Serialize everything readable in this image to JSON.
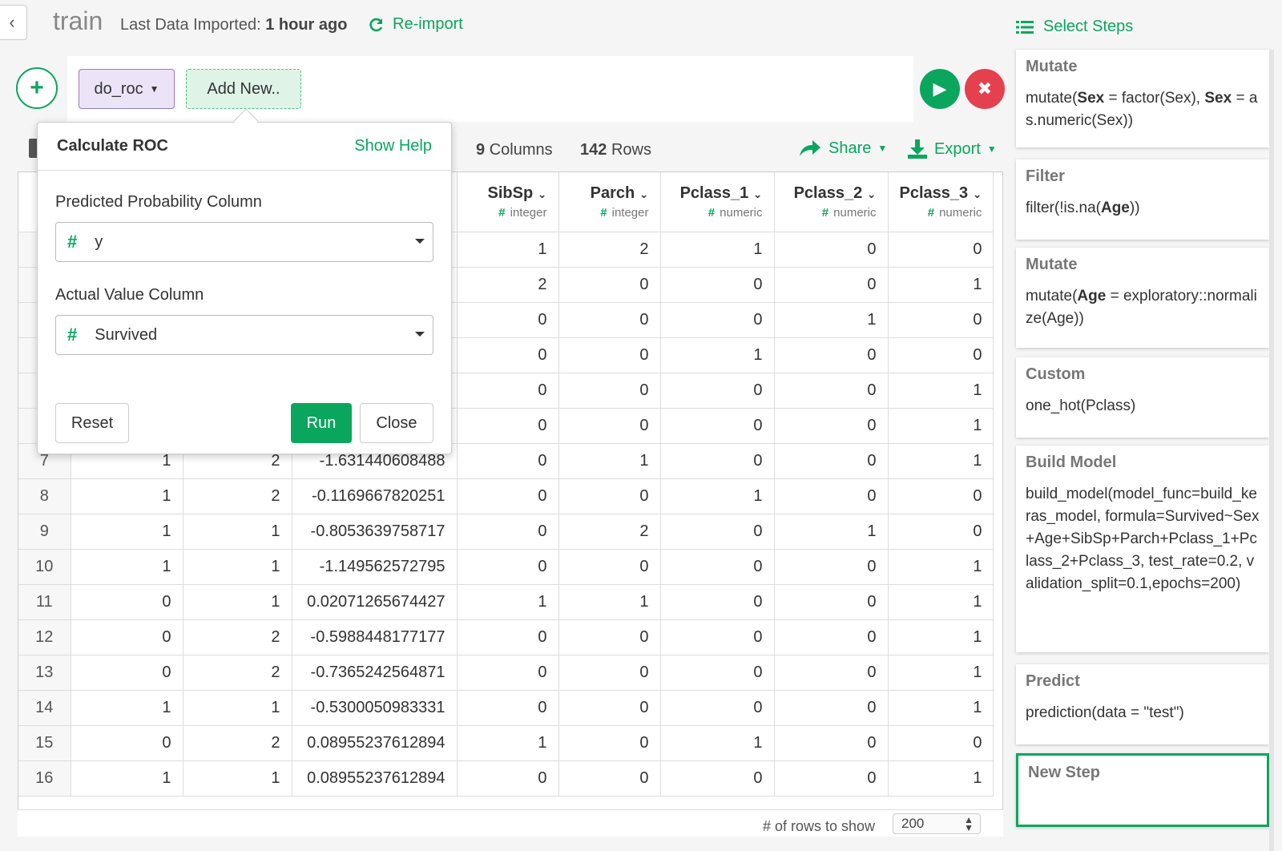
{
  "header": {
    "back_icon": "chevron-left-icon",
    "title": "train",
    "imported_label": "Last Data Imported:",
    "imported_value": "1 hour ago",
    "reimport_label": "Re-import"
  },
  "stepbar": {
    "current_step": "do_roc",
    "add_new_label": "Add New.."
  },
  "info": {
    "columns_count": "9",
    "columns_label": "Columns",
    "rows_count": "142",
    "rows_label": "Rows",
    "share_label": "Share",
    "export_label": "Export"
  },
  "table": {
    "columns": [
      {
        "name": "SibSp",
        "type": "integer"
      },
      {
        "name": "Parch",
        "type": "integer"
      },
      {
        "name": "Pclass_1",
        "type": "numeric"
      },
      {
        "name": "Pclass_2",
        "type": "numeric"
      },
      {
        "name": "Pclass_3",
        "type": "numeric"
      }
    ],
    "rows": [
      {
        "idx": "",
        "a": "",
        "b": "",
        "c": "",
        "sibsp": "1",
        "parch": "2",
        "p1": "1",
        "p2": "0",
        "p3": "0"
      },
      {
        "idx": "",
        "a": "",
        "b": "",
        "c": "",
        "sibsp": "2",
        "parch": "0",
        "p1": "0",
        "p2": "0",
        "p3": "1"
      },
      {
        "idx": "",
        "a": "",
        "b": "",
        "c": "",
        "sibsp": "0",
        "parch": "0",
        "p1": "0",
        "p2": "1",
        "p3": "0"
      },
      {
        "idx": "",
        "a": "",
        "b": "",
        "c": "",
        "sibsp": "0",
        "parch": "0",
        "p1": "1",
        "p2": "0",
        "p3": "0"
      },
      {
        "idx": "",
        "a": "",
        "b": "",
        "c": "",
        "sibsp": "0",
        "parch": "0",
        "p1": "0",
        "p2": "0",
        "p3": "1"
      },
      {
        "idx": "",
        "a": "",
        "b": "",
        "c": "",
        "sibsp": "0",
        "parch": "0",
        "p1": "0",
        "p2": "0",
        "p3": "1"
      },
      {
        "idx": "7",
        "a": "1",
        "b": "2",
        "c": "-1.631440608488",
        "sibsp": "0",
        "parch": "1",
        "p1": "0",
        "p2": "0",
        "p3": "1"
      },
      {
        "idx": "8",
        "a": "1",
        "b": "2",
        "c": "-0.1169667820251",
        "sibsp": "0",
        "parch": "0",
        "p1": "1",
        "p2": "0",
        "p3": "0"
      },
      {
        "idx": "9",
        "a": "1",
        "b": "1",
        "c": "-0.8053639758717",
        "sibsp": "0",
        "parch": "2",
        "p1": "0",
        "p2": "1",
        "p3": "0"
      },
      {
        "idx": "10",
        "a": "1",
        "b": "1",
        "c": "-1.149562572795",
        "sibsp": "0",
        "parch": "0",
        "p1": "0",
        "p2": "0",
        "p3": "1"
      },
      {
        "idx": "11",
        "a": "0",
        "b": "1",
        "c": "0.02071265674427",
        "sibsp": "1",
        "parch": "1",
        "p1": "0",
        "p2": "0",
        "p3": "1"
      },
      {
        "idx": "12",
        "a": "0",
        "b": "2",
        "c": "-0.5988448177177",
        "sibsp": "0",
        "parch": "0",
        "p1": "0",
        "p2": "0",
        "p3": "1"
      },
      {
        "idx": "13",
        "a": "0",
        "b": "2",
        "c": "-0.7365242564871",
        "sibsp": "0",
        "parch": "0",
        "p1": "0",
        "p2": "0",
        "p3": "1"
      },
      {
        "idx": "14",
        "a": "1",
        "b": "1",
        "c": "-0.5300050983331",
        "sibsp": "0",
        "parch": "0",
        "p1": "0",
        "p2": "0",
        "p3": "1"
      },
      {
        "idx": "15",
        "a": "0",
        "b": "2",
        "c": "0.08955237612894",
        "sibsp": "1",
        "parch": "0",
        "p1": "1",
        "p2": "0",
        "p3": "0"
      },
      {
        "idx": "16",
        "a": "1",
        "b": "1",
        "c": "0.08955237612894",
        "sibsp": "0",
        "parch": "0",
        "p1": "0",
        "p2": "0",
        "p3": "1"
      }
    ],
    "rows_to_show_label": "# of rows to show",
    "rows_to_show_value": "200"
  },
  "popup": {
    "title": "Calculate ROC",
    "show_help": "Show Help",
    "predicted_label": "Predicted Probability Column",
    "predicted_value": "y",
    "actual_label": "Actual Value Column",
    "actual_value": "Survived",
    "reset_label": "Reset",
    "run_label": "Run",
    "close_label": "Close"
  },
  "steps": {
    "select_label": "Select Steps",
    "items": [
      {
        "name": "Mutate",
        "code_html": "mutate(<b>Sex</b> = factor(Sex), <b>Sex</b> = as.numeric(Sex))"
      },
      {
        "name": "Filter",
        "code_html": "filter(!is.na(<b>Age</b>))"
      },
      {
        "name": "Mutate",
        "code_html": "mutate(<b>Age</b> = exploratory::normalize(Age))"
      },
      {
        "name": "Custom",
        "code_html": "one_hot(Pclass)"
      },
      {
        "name": "Build Model",
        "code_html": "build_model(model_func=build_keras_model, formula=Survived~Sex+Age+SibSp+Parch+Pclass_1+Pclass_2+Pclass_3, test_rate=0.2, validation_split=0.1,epochs=200)"
      },
      {
        "name": "Predict",
        "code_html": "prediction(data = \"test\")"
      },
      {
        "name": "New Step",
        "code_html": ""
      }
    ]
  },
  "colors": {
    "accent": "#0aa65e",
    "danger": "#e4404e",
    "roc_chip": "#ece3f7",
    "new_chip": "#dff3e6"
  }
}
